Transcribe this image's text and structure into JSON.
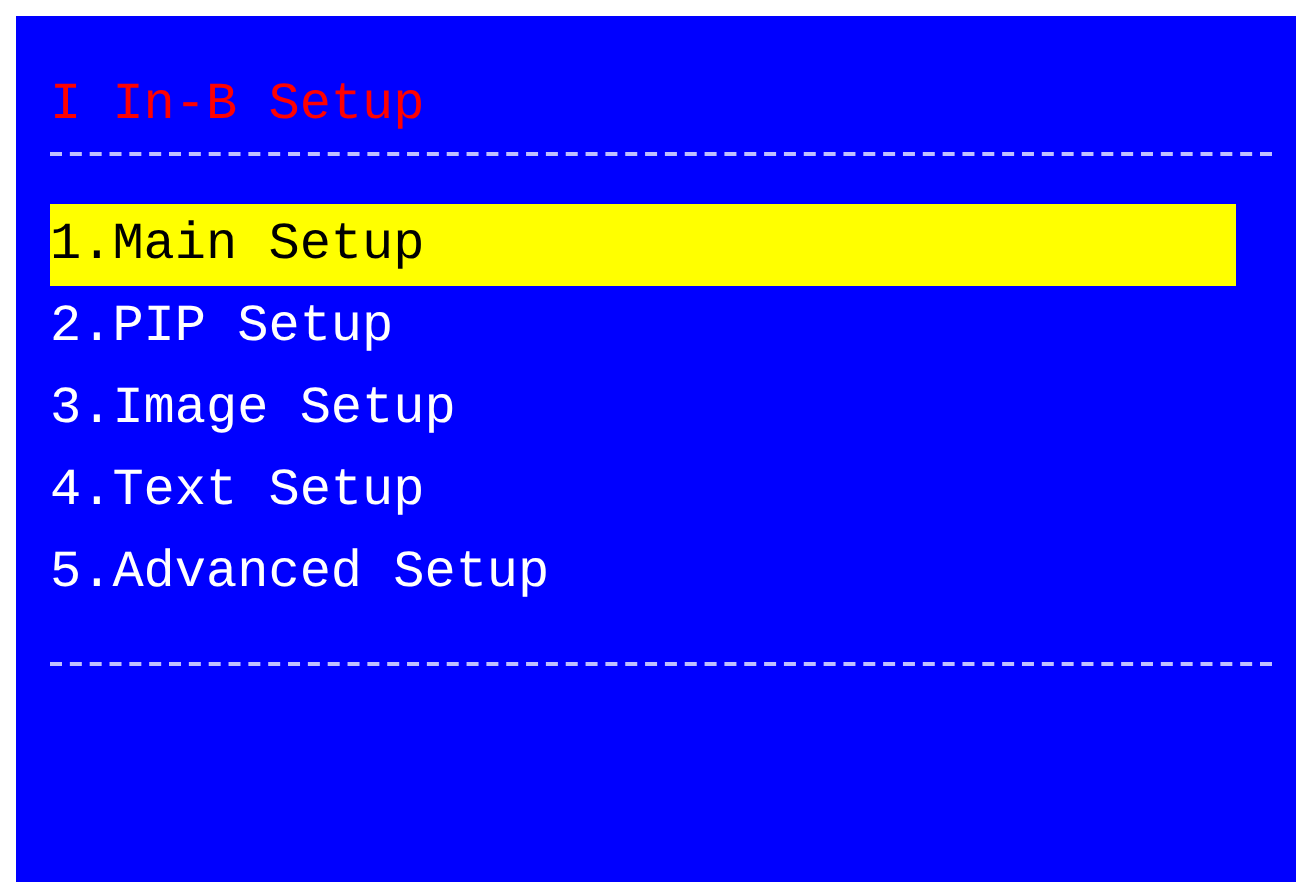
{
  "title": "I In-B Setup",
  "menu": [
    {
      "label": "1.Main Setup",
      "selected": true
    },
    {
      "label": "2.PIP Setup",
      "selected": false
    },
    {
      "label": "3.Image Setup",
      "selected": false
    },
    {
      "label": "4.Text Setup",
      "selected": false
    },
    {
      "label": "5.Advanced Setup",
      "selected": false
    }
  ]
}
